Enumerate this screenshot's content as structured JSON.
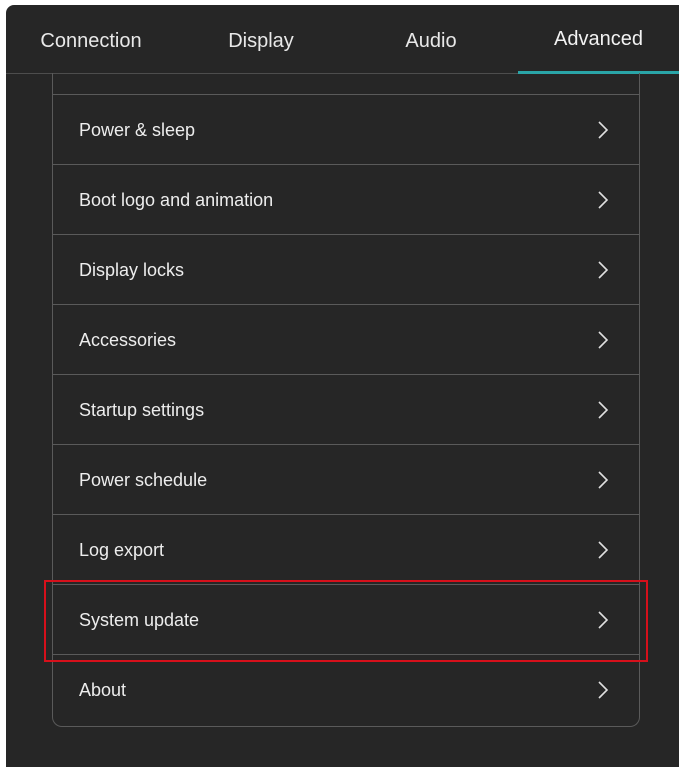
{
  "tabs": [
    {
      "label": "Connection"
    },
    {
      "label": "Display"
    },
    {
      "label": "Audio"
    },
    {
      "label": "Advanced",
      "active": true
    }
  ],
  "accent_color": "#2aa5a8",
  "highlight_color": "#d6101b",
  "menu": {
    "items": [
      {
        "label": "Power & sleep",
        "icon": "chevron-right-icon"
      },
      {
        "label": "Boot logo and animation",
        "icon": "chevron-right-icon"
      },
      {
        "label": "Display locks",
        "icon": "chevron-right-icon"
      },
      {
        "label": "Accessories",
        "icon": "chevron-right-icon"
      },
      {
        "label": "Startup settings",
        "icon": "chevron-right-icon"
      },
      {
        "label": "Power schedule",
        "icon": "chevron-right-icon"
      },
      {
        "label": "Log export",
        "icon": "chevron-right-icon"
      },
      {
        "label": "System update",
        "icon": "chevron-right-icon",
        "highlighted": true
      },
      {
        "label": "About",
        "icon": "chevron-right-icon"
      }
    ]
  }
}
